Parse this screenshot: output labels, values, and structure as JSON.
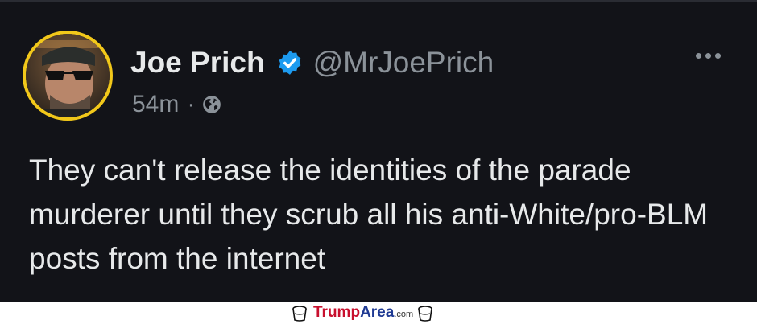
{
  "tweet": {
    "display_name": "Joe Prich",
    "handle": "@MrJoePrich",
    "time": "54m",
    "separator": "·",
    "text": "They can't release the identities of the parade murderer until they scrub all his anti-White/pro-BLM posts from the internet",
    "icons": {
      "verified": "verified-badge-icon",
      "visibility": "globe-icon",
      "more": "more-options-icon"
    },
    "colors": {
      "background": "#121318",
      "text": "#e7e9ea",
      "muted": "#8b9299",
      "verified": "#1d9bf0",
      "avatar_ring": "#f2c81a"
    }
  },
  "footer": {
    "brand_part1": "Trump",
    "brand_part2": "Area",
    "brand_part3": ".com",
    "colors": {
      "red": "#c8102e",
      "blue": "#1f3a93"
    }
  }
}
